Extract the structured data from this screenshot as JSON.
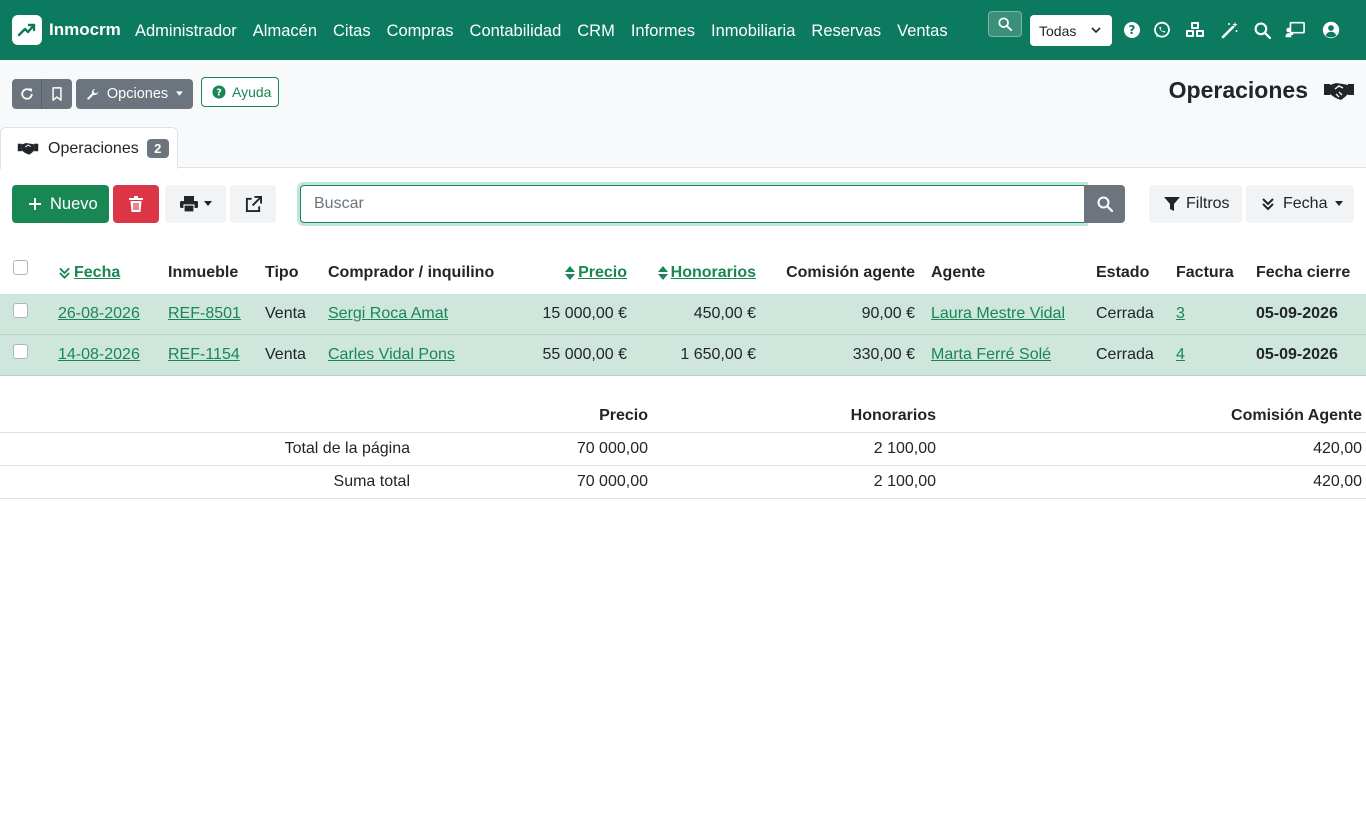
{
  "navbar": {
    "brand": "Inmocrm",
    "menu": [
      "Administrador",
      "Almacén",
      "Citas",
      "Compras",
      "Contabilidad",
      "CRM",
      "Informes",
      "Inmobiliaria",
      "Reservas",
      "Ventas"
    ],
    "company_select": "Todas",
    "icons": [
      "search-icon",
      "question-circle-icon",
      "whatsapp-icon",
      "cubes-icon",
      "magic-wand-icon",
      "search-icon",
      "chalkboard-user-icon",
      "user-circle-icon"
    ]
  },
  "page": {
    "title": "Operaciones",
    "options_label": "Opciones",
    "help_label": "Ayuda",
    "tab": {
      "label": "Operaciones",
      "count": "2"
    }
  },
  "toolbar": {
    "new_label": "Nuevo",
    "search_placeholder": "Buscar",
    "search_value": "",
    "filters_label": "Filtros",
    "sort_label": "Fecha"
  },
  "table": {
    "columns": {
      "fecha": "Fecha",
      "inmueble": "Inmueble",
      "tipo": "Tipo",
      "comprador": "Comprador / inquilino",
      "precio": "Precio",
      "honorarios": "Honorarios",
      "comision": "Comisión agente",
      "agente": "Agente",
      "estado": "Estado",
      "factura": "Factura",
      "fecha_cierre": "Fecha cierre"
    },
    "rows": [
      {
        "fecha": "26-08-2026",
        "inmueble": "REF-8501",
        "tipo": "Venta",
        "comprador": "Sergi Roca Amat",
        "precio": "15 000,00 €",
        "honorarios": "450,00 €",
        "comision": "90,00 €",
        "agente": "Laura Mestre Vidal",
        "estado": "Cerrada",
        "factura": "3",
        "fecha_cierre": "05-09-2026"
      },
      {
        "fecha": "14-08-2026",
        "inmueble": "REF-1154",
        "tipo": "Venta",
        "comprador": "Carles Vidal Pons",
        "precio": "55 000,00 €",
        "honorarios": "1 650,00 €",
        "comision": "330,00 €",
        "agente": "Marta Ferré Solé",
        "estado": "Cerrada",
        "factura": "4",
        "fecha_cierre": "05-09-2026"
      }
    ]
  },
  "totals": {
    "headers": {
      "precio": "Precio",
      "honorarios": "Honorarios",
      "comision": "Comisión Agente"
    },
    "page_total": {
      "label": "Total de la página",
      "precio": "70 000,00",
      "honorarios": "2 100,00",
      "comision": "420,00"
    },
    "grand_total": {
      "label": "Suma total",
      "precio": "70 000,00",
      "honorarios": "2 100,00",
      "comision": "420,00"
    }
  },
  "colors": {
    "navbar": "#0b7a5f",
    "primary": "#198754",
    "danger": "#dc3545",
    "secondary": "#6c757d",
    "row_highlight": "#cfe6dd"
  }
}
